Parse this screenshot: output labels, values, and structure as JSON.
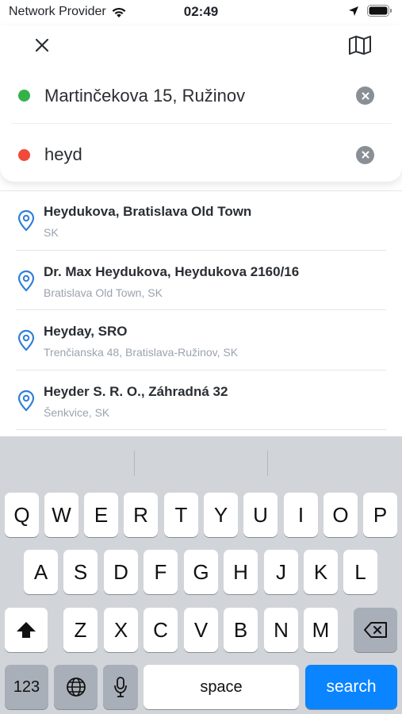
{
  "status_bar": {
    "carrier": "Network Provider",
    "time": "02:49"
  },
  "route": {
    "from": {
      "text": "Martinčekova 15, Ružinov",
      "dot_color": "#34b24a"
    },
    "to": {
      "text": "heyd",
      "dot_color": "#f04a3a"
    }
  },
  "results": [
    {
      "title": "Heydukova, Bratislava Old Town",
      "subtitle": "SK"
    },
    {
      "title": "Dr. Max Heydukova, Heydukova 2160/16",
      "subtitle": "Bratislava Old Town, SK"
    },
    {
      "title": "Heyday, SRO",
      "subtitle": "Trenčianska 48, Bratislava-Ružinov, SK"
    },
    {
      "title": "Heyder S. R. O., Záhradná 32",
      "subtitle": "Šenkvice, SK"
    }
  ],
  "keyboard": {
    "row1": [
      "Q",
      "W",
      "E",
      "R",
      "T",
      "Y",
      "U",
      "I",
      "O",
      "P"
    ],
    "row2": [
      "A",
      "S",
      "D",
      "F",
      "G",
      "H",
      "J",
      "K",
      "L"
    ],
    "row3": [
      "Z",
      "X",
      "C",
      "V",
      "B",
      "N",
      "M"
    ],
    "numbers_label": "123",
    "space_label": "space",
    "search_label": "search"
  },
  "colors": {
    "accent": "#0a84ff",
    "pin": "#2f7fd8"
  }
}
